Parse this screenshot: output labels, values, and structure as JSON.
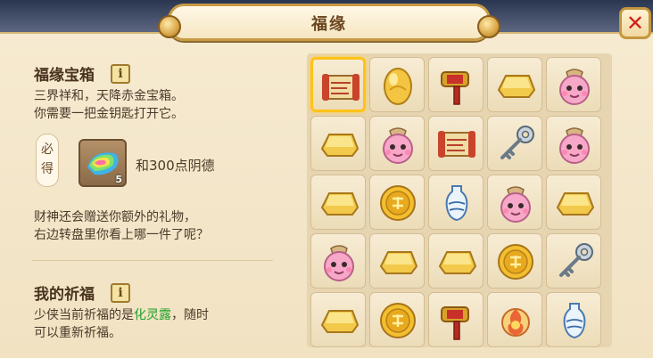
{
  "window": {
    "title": "福缘",
    "close_label": "✕"
  },
  "treasure": {
    "heading": "福缘宝箱",
    "info_label": "i",
    "line1": "三界祥和，天降赤金宝箱。",
    "line2": "你需要一把金钥匙打开它。",
    "must_get_label_1": "必",
    "must_get_label_2": "得",
    "reward_count": "5",
    "reward_text": "和300点阴德",
    "extra_line1": "财神还会赠送你额外的礼物，",
    "extra_line2": "右边转盘里你看上哪一件了呢？"
  },
  "blessing": {
    "heading": "我的祈福",
    "info_label": "i",
    "prefix": "少侠当前祈福的是",
    "item_name": "化灵露",
    "suffix": "，随时",
    "line2": "可以重新祈福。"
  },
  "grid": {
    "selected_index": 0,
    "items": [
      "scroll-icon",
      "golden-egg-icon",
      "golden-hammer-icon",
      "gold-ingot-icon",
      "pink-pouch-icon",
      "gold-ingot-icon",
      "pink-pouch-icon",
      "scroll-icon",
      "silver-key-icon",
      "pink-pouch-icon",
      "gold-ingot-icon",
      "gold-coin-icon",
      "porcelain-vase-icon",
      "pink-pouch-icon",
      "gold-ingot-icon",
      "pink-pouch-icon",
      "gold-ingot-icon",
      "gold-ingot-icon",
      "gold-coin-icon",
      "silver-key-icon",
      "gold-ingot-icon",
      "gold-coin-icon",
      "golden-hammer-icon",
      "fire-orb-icon",
      "porcelain-vase-icon"
    ]
  },
  "colors": {
    "accent_gold": "#c89a45",
    "highlight": "#ffc21a",
    "item_name_green": "#22a02a",
    "close_red": "#d0201a"
  }
}
